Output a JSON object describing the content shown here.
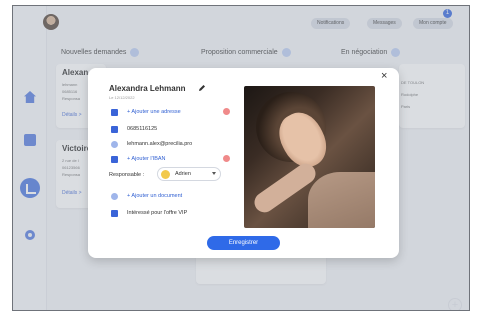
{
  "topbar": {
    "buttons": [
      "Notifications",
      "Messages",
      "Mon compte"
    ],
    "notification_count": "1"
  },
  "columns": [
    {
      "title": "Nouvelles demandes"
    },
    {
      "title": "Proposition commerciale"
    },
    {
      "title": "En négociation"
    }
  ],
  "background_cards": [
    {
      "name": "Alexan",
      "lines": [
        "lehmann",
        "0685116",
        "Responsa"
      ],
      "link": "Détails >"
    },
    {
      "name": "Victoire",
      "lines": [
        "2 rue de l",
        "06123566",
        "Responsa"
      ],
      "link": "Détails >"
    }
  ],
  "background_right_card": {
    "lines": [
      "DE TOULON",
      "Rodolphe",
      "Paris"
    ]
  },
  "modal": {
    "name": "Alexandra Lehmann",
    "date": "Le 12/12/2022",
    "rows": {
      "address": "+ Ajouter une adresse",
      "phone": "0685116125",
      "email": "lehmann.alex@precilia.pro",
      "iban": "+ Ajouter l'IBAN",
      "document": "+ Ajouter un document",
      "offer": "Intéressé pour l'offre VIP"
    },
    "responsable_label": "Responsable :",
    "responsable_value": "Adrien",
    "save_label": "Enregistrer",
    "close_glyph": "×"
  },
  "fab_glyph": "+",
  "colors": {
    "accent": "#2f6ae8",
    "alert": "#f08a8a"
  }
}
